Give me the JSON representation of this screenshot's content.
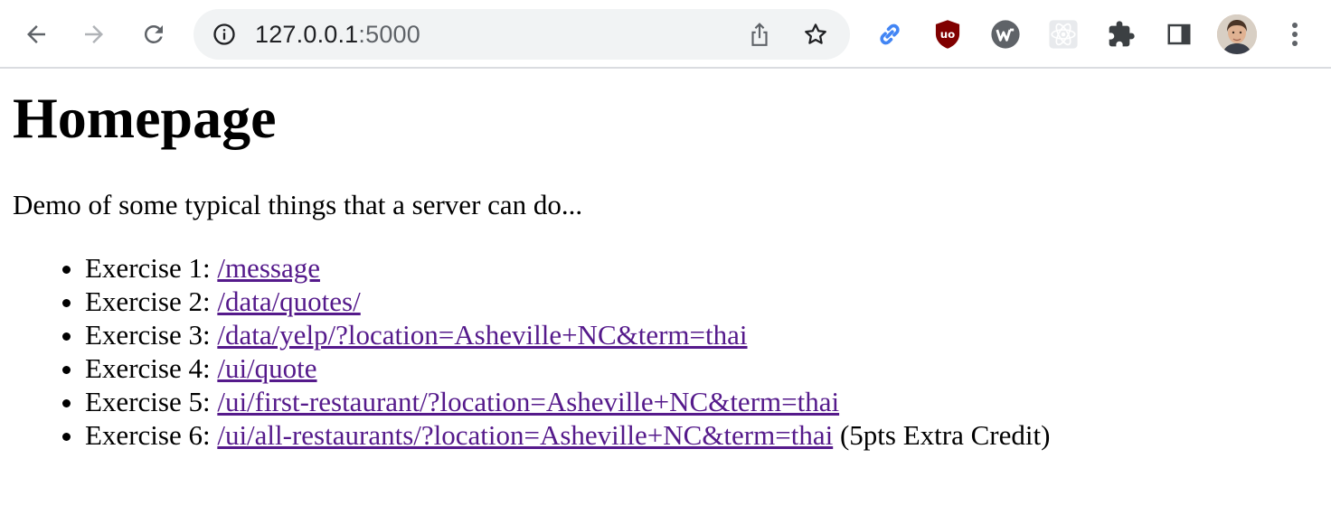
{
  "browser": {
    "url_host": "127.0.0.1",
    "url_port": ":5000",
    "icons": [
      "back-icon",
      "forward-icon",
      "reload-icon",
      "site-info-icon",
      "share-icon",
      "bookmark-star-icon",
      "link-extension-icon",
      "ublock-extension-icon",
      "w-extension-icon",
      "react-devtools-icon",
      "extensions-puzzle-icon",
      "side-panel-icon",
      "profile-avatar",
      "menu-kebab-icon"
    ]
  },
  "page": {
    "heading": "Homepage",
    "intro": "Demo of some typical things that a server can do...",
    "exercises": [
      {
        "label": "Exercise 1: ",
        "link": "/message",
        "suffix": ""
      },
      {
        "label": "Exercise 2: ",
        "link": "/data/quotes/",
        "suffix": ""
      },
      {
        "label": "Exercise 3: ",
        "link": "/data/yelp/?location=Asheville+NC&term=thai",
        "suffix": ""
      },
      {
        "label": "Exercise 4: ",
        "link": "/ui/quote",
        "suffix": ""
      },
      {
        "label": "Exercise 5: ",
        "link": "/ui/first-restaurant/?location=Asheville+NC&term=thai",
        "suffix": ""
      },
      {
        "label": "Exercise 6: ",
        "link": "/ui/all-restaurants/?location=Asheville+NC&term=thai",
        "suffix": " (5pts Extra Credit)"
      }
    ]
  },
  "colors": {
    "link_visited": "#551a8b",
    "toolbar_bg": "#ffffff",
    "omnibox_bg": "#f1f3f4",
    "icon_gray": "#5f6368"
  }
}
